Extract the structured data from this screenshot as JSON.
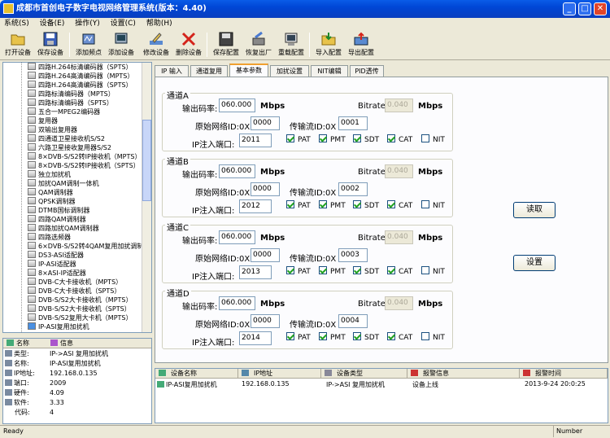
{
  "window": {
    "title": "成都市首创电子数字电视网络管理系统(版本：4.40)",
    "min": "_",
    "max": "□",
    "close": "✕"
  },
  "menu": [
    "系统(S)",
    "设备(E)",
    "操作(Y)",
    "设置(C)",
    "帮助(H)"
  ],
  "toolbar": [
    "打开设备",
    "保存设备",
    "添加频点",
    "添加设备",
    "修改设备",
    "删除设备",
    "保存配置",
    "恢复出厂",
    "重载配置",
    "导入配置",
    "导出配置"
  ],
  "tree": [
    "四路H.264标清编码器（SPTS）",
    "四路H.264高清编码器（MPTS）",
    "四路H.264高清编码器（SPTS）",
    "四路标清编码器（MPTS）",
    "四路标清编码器（SPTS）",
    "五合一MPEG2编码器",
    "复用器",
    "双输出复用器",
    "四通道卫星接收机S/S2",
    "六路卫星接收复用器S/S2",
    "8×DVB-S/S2转IP接收机（MPTS）",
    "8×DVB-S/S2转IP接收机（SPTS）",
    "独立加扰机",
    "加扰QAM调制一体机",
    "QAM调制器",
    "QPSK调制器",
    "DTMB国标调制器",
    "四路QAM调制器",
    "四路加扰QAM调制器",
    "四路选频器",
    "6×DVB-S/S2转4QAM复用加扰调制器",
    "DS3-ASI适配器",
    "IP-ASI适配器",
    "8×ASI-IP适配器",
    "DVB-C大卡接收机（MPTS）",
    "DVB-C大卡接收机（SPTS）",
    "DVB-S/S2大卡接收机（MPTS）",
    "DVB-S/S2大卡接收机（SPTS）",
    "DVB-S/S2复用大卡机（MPTS）",
    "IP-ASI复用加扰机"
  ],
  "info": {
    "col_name": "名称",
    "col_info": "信息",
    "rows": [
      [
        "类型:",
        "IP->ASI 复用加扰机"
      ],
      [
        "名称:",
        "IP-ASI复用加扰机"
      ],
      [
        "IP地址:",
        "192.168.0.135"
      ],
      [
        "端口:",
        "2009"
      ],
      [
        "硬件:",
        "4.09"
      ],
      [
        "软件:",
        "3.33"
      ],
      [
        "代码:",
        "4"
      ]
    ]
  },
  "tabs": [
    "IP 输入",
    "通道复用",
    "基本参数",
    "加扰设置",
    "NIT编辑",
    "PID透传"
  ],
  "channels": [
    {
      "title": "通道A",
      "rate_label": "输出码率:",
      "rate": "060.000",
      "mbps": "Mbps",
      "bitrate_label": "Bitrate",
      "bitrate": "0.040",
      "netid_label": "原始网络ID:0X",
      "netid": "0000",
      "tsid_label": "传输流ID:0X",
      "tsid": "0001",
      "port_label": "IP注入端口:",
      "port": "2011",
      "checks": [
        [
          "PAT",
          true
        ],
        [
          "PMT",
          true
        ],
        [
          "SDT",
          true
        ],
        [
          "CAT",
          true
        ],
        [
          "NIT",
          false
        ]
      ]
    },
    {
      "title": "通道B",
      "rate_label": "输出码率:",
      "rate": "060.000",
      "mbps": "Mbps",
      "bitrate_label": "Bitrate",
      "bitrate": "0.040",
      "netid_label": "原始网络ID:0X",
      "netid": "0000",
      "tsid_label": "传输流ID:0X",
      "tsid": "0002",
      "port_label": "IP注入端口:",
      "port": "2012",
      "checks": [
        [
          "PAT",
          true
        ],
        [
          "PMT",
          true
        ],
        [
          "SDT",
          true
        ],
        [
          "CAT",
          true
        ],
        [
          "NIT",
          false
        ]
      ]
    },
    {
      "title": "通道C",
      "rate_label": "输出码率:",
      "rate": "060.000",
      "mbps": "Mbps",
      "bitrate_label": "Bitrate",
      "bitrate": "0.040",
      "netid_label": "原始网络ID:0X",
      "netid": "0000",
      "tsid_label": "传输流ID:0X",
      "tsid": "0003",
      "port_label": "IP注入端口:",
      "port": "2013",
      "checks": [
        [
          "PAT",
          true
        ],
        [
          "PMT",
          true
        ],
        [
          "SDT",
          true
        ],
        [
          "CAT",
          true
        ],
        [
          "NIT",
          false
        ]
      ]
    },
    {
      "title": "通道D",
      "rate_label": "输出码率:",
      "rate": "060.000",
      "mbps": "Mbps",
      "bitrate_label": "Bitrate",
      "bitrate": "0.040",
      "netid_label": "原始网络ID:0X",
      "netid": "0000",
      "tsid_label": "传输流ID:0X",
      "tsid": "0004",
      "port_label": "IP注入端口:",
      "port": "2014",
      "checks": [
        [
          "PAT",
          true
        ],
        [
          "PMT",
          true
        ],
        [
          "SDT",
          true
        ],
        [
          "CAT",
          true
        ],
        [
          "NIT",
          false
        ]
      ]
    }
  ],
  "buttons": {
    "read": "读取",
    "set": "设置"
  },
  "log": {
    "headers": [
      "设备名称",
      "IP地址",
      "设备类型",
      "报警信息",
      "报警时间"
    ],
    "row": [
      "IP-ASI复用加扰机",
      "192.168.0.135",
      "IP->ASI 复用加扰机",
      "设备上线",
      "2013-9-24 20:0:25"
    ]
  },
  "status": {
    "left": "Ready",
    "right": "Number"
  }
}
